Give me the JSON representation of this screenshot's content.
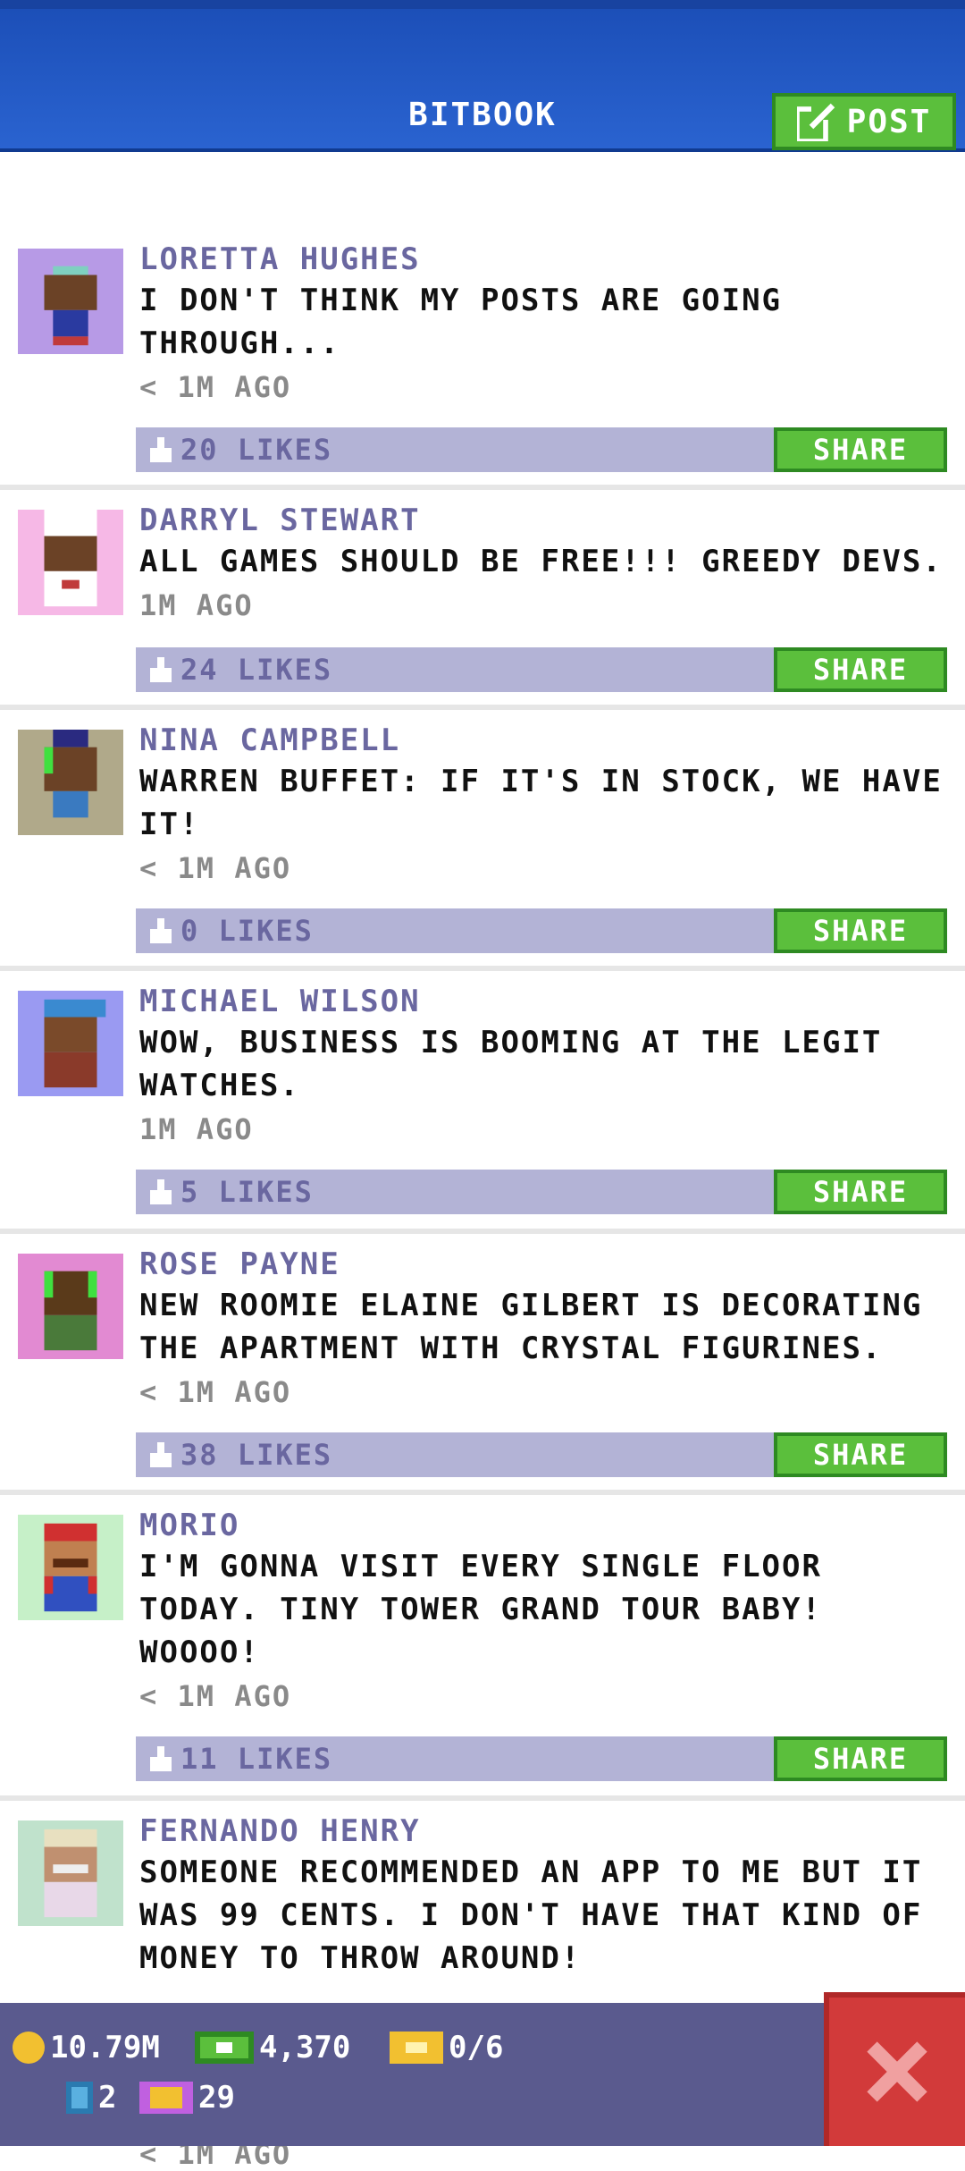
{
  "header": {
    "title": "BITBOOK",
    "post_label": "POST"
  },
  "posts": [
    {
      "author": "LORETTA HUGHES",
      "message": "I DON'T THINK MY POSTS ARE GOING THROUGH...",
      "time": "< 1M AGO",
      "likes": "20 LIKES",
      "share": "SHARE",
      "avatar_bg": "#b79ae6"
    },
    {
      "author": "DARRYL STEWART",
      "message": "ALL GAMES SHOULD BE FREE!!! GREEDY DEVS.",
      "time": "1M AGO",
      "likes": "24 LIKES",
      "share": "SHARE",
      "avatar_bg": "#f6b8e6"
    },
    {
      "author": "NINA CAMPBELL",
      "message": "WARREN BUFFET: IF IT'S IN STOCK, WE HAVE IT!",
      "time": "< 1M AGO",
      "likes": "0 LIKES",
      "share": "SHARE",
      "avatar_bg": "#b0a98a"
    },
    {
      "author": "MICHAEL WILSON",
      "message": "WOW, BUSINESS IS BOOMING AT THE LEGIT WATCHES.",
      "time": "1M AGO",
      "likes": "5 LIKES",
      "share": "SHARE",
      "avatar_bg": "#9a9af2"
    },
    {
      "author": "ROSE PAYNE",
      "message": "NEW ROOMIE ELAINE GILBERT IS DECORATING THE APARTMENT WITH CRYSTAL FIGURINES.",
      "time": "< 1M AGO",
      "likes": "38 LIKES",
      "share": "SHARE",
      "avatar_bg": "#e28ad2"
    },
    {
      "author": "MORIO",
      "message": "I'M GONNA VISIT EVERY SINGLE FLOOR TODAY. TINY TOWER GRAND TOUR BABY! WOOOO!",
      "time": "< 1M AGO",
      "likes": "11 LIKES",
      "share": "SHARE",
      "avatar_bg": "#c6f0c8"
    },
    {
      "author": "FERNANDO HENRY",
      "message": "SOMEONE RECOMMENDED AN APP TO ME BUT IT WAS 99 CENTS. I DON'T HAVE THAT KIND OF MONEY TO THROW AROUND!",
      "time": "< 1M AGO",
      "likes": "",
      "share": "",
      "avatar_bg": "#c0e2cc"
    }
  ],
  "status": {
    "coins": "10.79M",
    "bux": "4,370",
    "tickets": "0/6",
    "keys": "2",
    "gold_tickets": "29"
  },
  "colors": {
    "accent_blue": "#2a63d0",
    "green": "#5bbf3c",
    "purple_text": "#6a67a0",
    "bottom_bar": "#5a5a8e",
    "close_red": "#d23a3a"
  }
}
